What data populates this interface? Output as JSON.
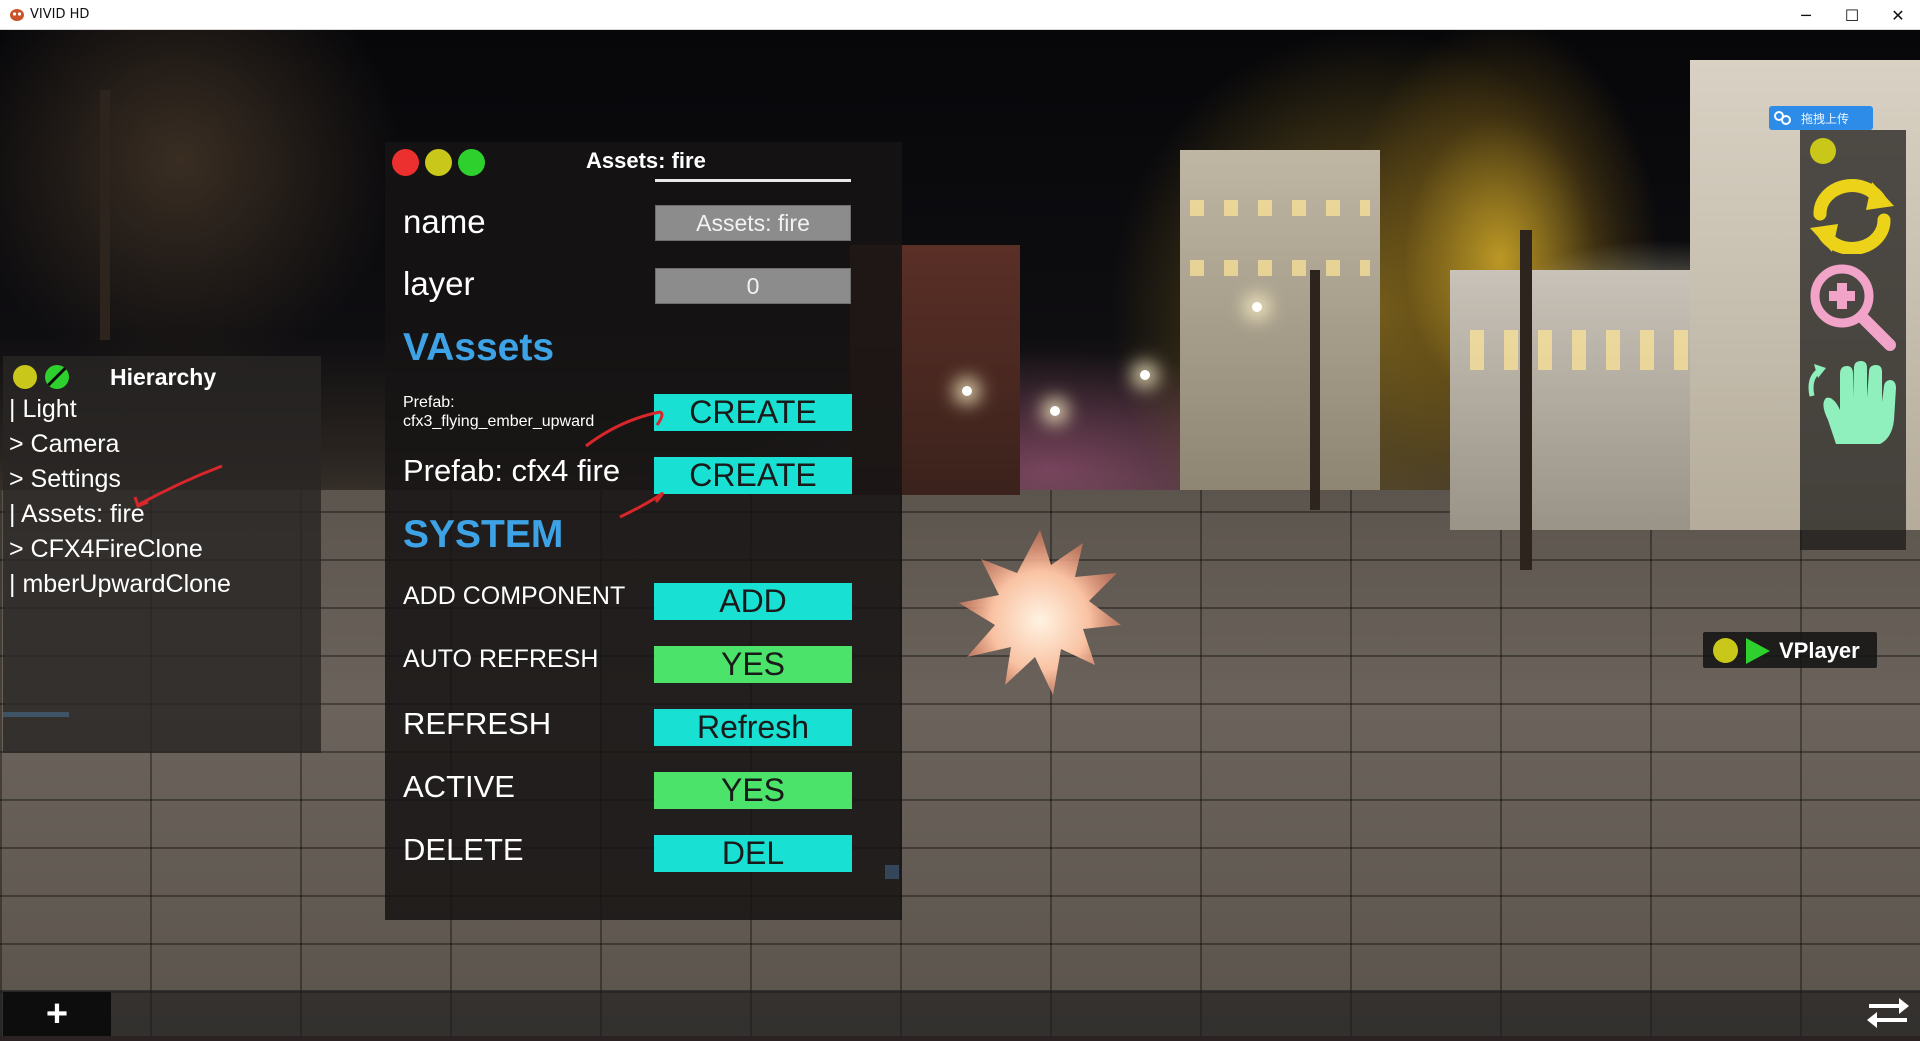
{
  "window": {
    "title": "VIVID HD",
    "minimize_glyph": "─",
    "maximize_glyph": "☐",
    "close_glyph": "✕"
  },
  "hierarchy": {
    "title": "Hierarchy",
    "items": [
      {
        "label": "| Light"
      },
      {
        "label": "> Camera"
      },
      {
        "label": "> Settings"
      },
      {
        "label": "| Assets: fire"
      },
      {
        "label": "> CFX4FireClone"
      },
      {
        "label": "| mberUpwardClone"
      }
    ]
  },
  "inspector": {
    "title": "Assets: fire",
    "name_label": "name",
    "name_value": "Assets: fire",
    "layer_label": "layer",
    "layer_value": "0",
    "section_assets": "VAssets",
    "prefab1_label_line1": "Prefab:",
    "prefab1_label_line2": "cfx3_flying_ember_upward",
    "prefab1_button": "CREATE",
    "prefab2_label": "Prefab: cfx4 fire",
    "prefab2_button": "CREATE",
    "section_system": "SYSTEM",
    "rows": [
      {
        "label": "ADD COMPONENT",
        "button": "ADD"
      },
      {
        "label": "AUTO REFRESH",
        "button": "YES"
      },
      {
        "label": "REFRESH",
        "button": "Refresh"
      },
      {
        "label": "ACTIVE",
        "button": "YES"
      },
      {
        "label": "DELETE",
        "button": "DEL"
      }
    ]
  },
  "upload": {
    "label": "拖拽上传"
  },
  "toolbar": {
    "icons": [
      "status-dot",
      "refresh-icon",
      "zoom-in-icon",
      "hand-pan-icon"
    ]
  },
  "vplayer": {
    "label": "VPlayer"
  },
  "bottom": {
    "add_glyph": "+"
  },
  "colors": {
    "cyan_button": "#18e0d2",
    "green_button": "#4be36a",
    "section_blue": "#3ea3e6",
    "icon_yellow": "#ecd31a",
    "icon_pink": "#f2a3c8",
    "icon_mint": "#8ff0bd"
  }
}
